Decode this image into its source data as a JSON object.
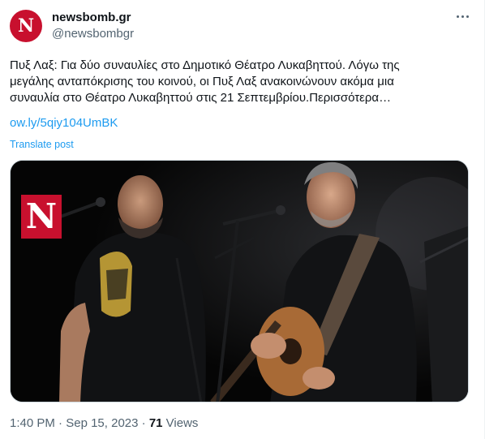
{
  "author": {
    "name": "newsbomb.gr",
    "handle": "@newsbombgr",
    "avatar_letter": "N",
    "brand_color": "#c8102e"
  },
  "tweet": {
    "text_lines": [
      "Πυξ Λαξ: Για δύο συναυλίες στο Δημοτικό Θέατρο Λυκαβηττού. Λόγω της",
      "μεγάλης ανταπόκρισης του κοινού, οι Πυξ Λαξ ανακοινώνουν ακόμα μια",
      "συναυλία στο Θέατρο Λυκαβηττού στις 21 Σεπτεμβρίου.Περισσότερα…"
    ],
    "link": "ow.ly/5qiy104UmBK",
    "translate": "Translate post",
    "link_color": "#1d9bf0"
  },
  "media": {
    "watermark_letter": "N"
  },
  "meta": {
    "time": "1:40 PM",
    "separator": "·",
    "date": "Sep 15, 2023",
    "views_count": "71",
    "views_label": "Views"
  },
  "icons": {
    "more": "more-options-icon"
  }
}
